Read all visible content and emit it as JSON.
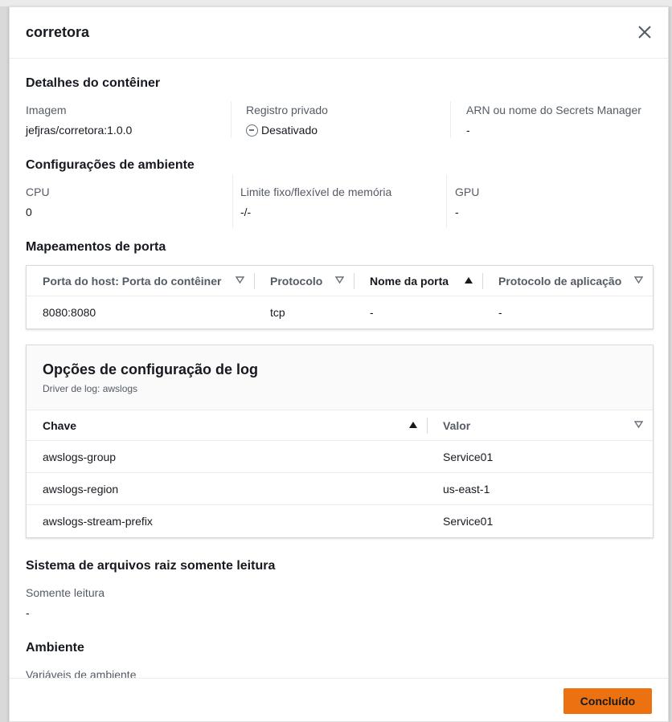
{
  "modal": {
    "title": "corretora",
    "done_label": "Concluído"
  },
  "container_details": {
    "title": "Detalhes do contêiner",
    "image_label": "Imagem",
    "image_value": "jefjras/corretora:1.0.0",
    "private_registry_label": "Registro privado",
    "private_registry_value": "Desativado",
    "secrets_label": "ARN ou nome do Secrets Manager",
    "secrets_value": "-"
  },
  "environment_config": {
    "title": "Configurações de ambiente",
    "cpu_label": "CPU",
    "cpu_value": "0",
    "memory_label": "Limite fixo/flexível de memória",
    "memory_value": "-/-",
    "gpu_label": "GPU",
    "gpu_value": "-"
  },
  "port_mappings": {
    "title": "Mapeamentos de porta",
    "columns": [
      "Porta do host: Porta do contêiner",
      "Protocolo",
      "Nome da porta",
      "Protocolo de aplicação"
    ],
    "rows": [
      [
        "8080:8080",
        "tcp",
        "-",
        "-"
      ]
    ]
  },
  "log_config": {
    "title": "Opções de configuração de log",
    "driver": "Driver de log: awslogs",
    "columns": [
      "Chave",
      "Valor"
    ],
    "rows": [
      [
        "awslogs-group",
        "Service01"
      ],
      [
        "awslogs-region",
        "us-east-1"
      ],
      [
        "awslogs-stream-prefix",
        "Service01"
      ]
    ]
  },
  "readonly_fs": {
    "title": "Sistema de arquivos raiz somente leitura",
    "label": "Somente leitura",
    "value": "-"
  },
  "environment": {
    "title": "Ambiente",
    "vars_label": "Variáveis de ambiente"
  }
}
